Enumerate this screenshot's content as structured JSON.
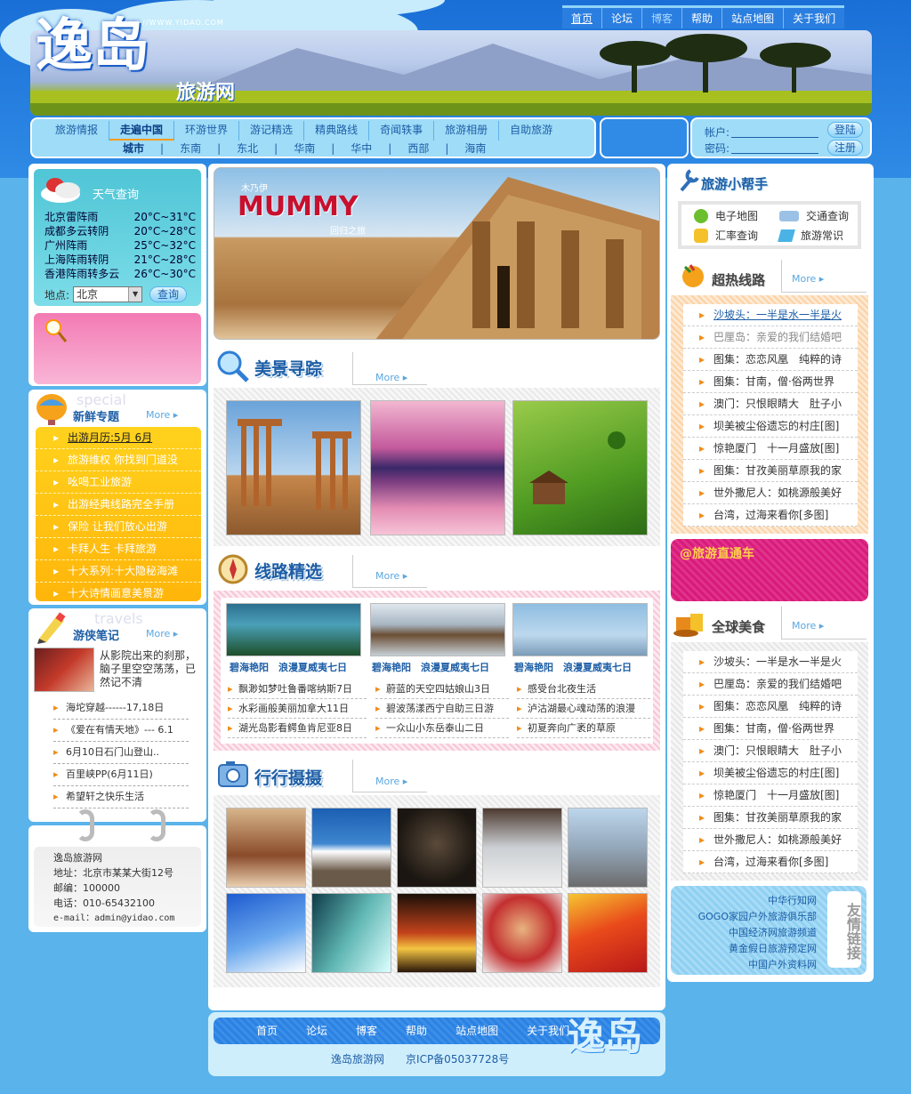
{
  "site": {
    "logo": "逸岛",
    "subtitle": "旅游网",
    "url": "HTTP://WWW.YIDAO.COM"
  },
  "topnav": [
    "首页",
    "论坛",
    "博客",
    "帮助",
    "站点地图",
    "关于我们"
  ],
  "mainnav": [
    "旅游情报",
    "走遍中国",
    "环游世界",
    "游记精选",
    "精典路线",
    "奇闻轶事",
    "旅游相册",
    "自助旅游"
  ],
  "subnav": {
    "label": "城市",
    "items": [
      "东南",
      "东北",
      "华南",
      "华中",
      "西部",
      "海南"
    ]
  },
  "login": {
    "account_label": "帐户:",
    "password_label": "密码:",
    "login_btn": "登陆",
    "register_btn": "注册"
  },
  "weather": {
    "title": "天气查询",
    "rows": [
      {
        "city": "北京",
        "desc": "雷阵雨",
        "temp": "20°C~31°C"
      },
      {
        "city": "成都",
        "desc": "多云转阴",
        "temp": "20°C~28°C"
      },
      {
        "city": "广州",
        "desc": "阵雨",
        "temp": "25°C~32°C"
      },
      {
        "city": "上海",
        "desc": "阵雨转阴",
        "temp": "21°C~28°C"
      },
      {
        "city": "香港",
        "desc": "阵雨转多云",
        "temp": "26°C~30°C"
      }
    ],
    "place_label": "地点:",
    "place_value": "北京",
    "query_btn": "查询"
  },
  "fresh": {
    "title": "新鲜专题",
    "watermark": "special",
    "more": "More",
    "items": [
      "出游月历:5月 6月",
      "旅游维权 你找到门道没",
      "吆喝工业旅游",
      "出游经典线路完全手册",
      "保险 让我们放心出游",
      "卡拜人生 卡拜旅游",
      "十大系列:十大隐秘海滩",
      "十大诗情画意美景游"
    ]
  },
  "notes": {
    "title": "游侠笔记",
    "watermark": "travels",
    "more": "More",
    "intro": "从影院出来的刹那，脑子里空空荡荡，已然记不清",
    "items": [
      "海坨穿越------17,18日",
      "《爱在有情天地》--- 6.1",
      "6月10日石门山登山..",
      "百里峡PP(6月11日)",
      "希望轩之快乐生活"
    ]
  },
  "contact": {
    "name": "逸岛旅游网",
    "address": "地址：北京市某某大街12号",
    "zip": "邮编：100000",
    "phone": "电话：010-65432100",
    "email": "e-mail：admin@yidao.com"
  },
  "hero": {
    "title_cn": "木乃伊",
    "title_en": "MUMMY",
    "tagline": "回归之旅"
  },
  "scenery": {
    "title": "美景寻踪",
    "more": "More"
  },
  "routes": {
    "title": "线路精选",
    "more": "More",
    "captions": [
      [
        "碧海艳阳",
        "浪漫夏威夷七日"
      ],
      [
        "碧海艳阳",
        "浪漫夏威夷七日"
      ],
      [
        "碧海艳阳",
        "浪漫夏威夷七日"
      ]
    ],
    "col1": [
      "飘渺如梦吐鲁番喀纳斯7日",
      "水彩画般美丽加拿大11日",
      "湖光岛影看鳄鱼肯尼亚8日"
    ],
    "col2": [
      "蔚蓝的天空四姑娘山3日",
      "碧波荡漾西宁自助三日游",
      "一众山小东岳泰山二日"
    ],
    "col3": [
      "感受台北夜生活",
      "泸沽湖最心魂动荡的浪漫",
      "初夏奔向广袤的草原"
    ]
  },
  "photos": {
    "title": "行行摄摄",
    "more": "More"
  },
  "footer": {
    "nav": [
      "首页",
      "论坛",
      "博客",
      "帮助",
      "站点地图",
      "关于我们"
    ],
    "site": "逸岛旅游网",
    "icp": "京ICP备05037728号",
    "logo": "逸岛"
  },
  "helper": {
    "title": "旅游小帮手",
    "items": [
      "电子地图",
      "交通查询",
      "汇率查询",
      "旅游常识"
    ]
  },
  "hot": {
    "title": "超热线路",
    "more": "More",
    "items": [
      "沙坡头：一半是水一半是火",
      "巴厘岛：亲爱的我们结婚吧",
      "图集：恋恋风凰　纯粹的诗",
      "图集：甘南，僧·俗两世界",
      "澳门：只恨眼睛大　肚子小",
      "坝美被尘俗遗忘的村庄[图]",
      "惊艳厦门　十一月盛放[图]",
      "图集：甘孜美丽草原我的家",
      "世外撒尼人：如桃源般美好",
      "台湾，过海来看你[多图]"
    ]
  },
  "express": {
    "title": "@旅游直通车"
  },
  "food": {
    "title": "全球美食",
    "more": "More",
    "items": [
      "沙坡头：一半是水一半是火",
      "巴厘岛：亲爱的我们结婚吧",
      "图集：恋恋风凰　纯粹的诗",
      "图集：甘南，僧·俗两世界",
      "澳门：只恨眼睛大　肚子小",
      "坝美被尘俗遗忘的村庄[图]",
      "惊艳厦门　十一月盛放[图]",
      "图集：甘孜美丽草原我的家",
      "世外撒尼人：如桃源般美好",
      "台湾，过海来看你[多图]"
    ]
  },
  "friendlinks": {
    "title": "友情链接",
    "items": [
      "中华行知网",
      "GOGO家园户外旅游俱乐部",
      "中国经济网旅游频道",
      "黄金假日旅游预定网",
      "中国户外资料网"
    ]
  }
}
